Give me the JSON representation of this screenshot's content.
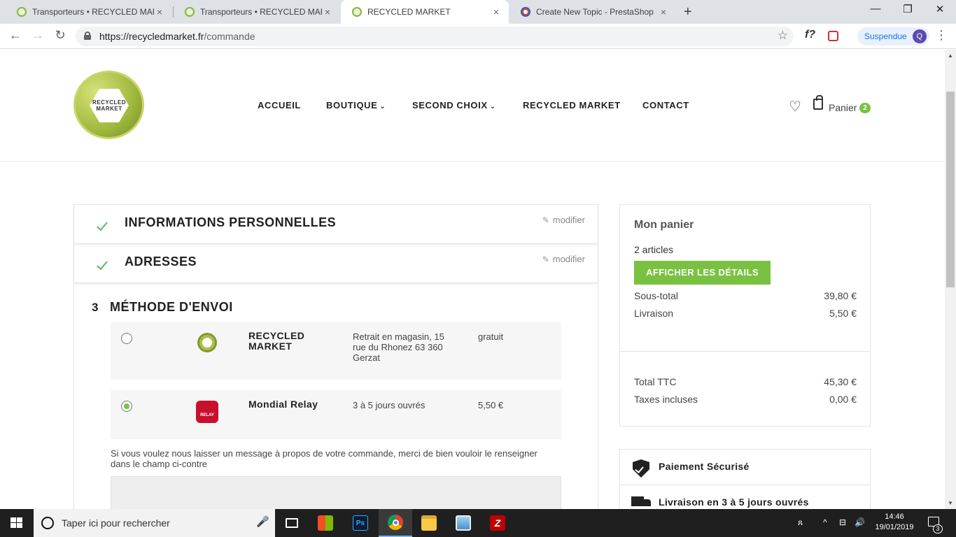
{
  "browser": {
    "tabs": [
      {
        "title": "Transporteurs • RECYCLED MARK",
        "close": "×"
      },
      {
        "title": "Transporteurs • RECYCLED MARK",
        "close": "×"
      },
      {
        "title": "RECYCLED MARKET",
        "close": "×"
      },
      {
        "title": "Create New Topic - PrestaShop",
        "close": "×"
      }
    ],
    "new_tab": "+",
    "window_controls": {
      "minimize": "—",
      "maximize": "❐",
      "close": "✕"
    },
    "nav": {
      "back": "←",
      "forward": "→",
      "reload": "↻"
    },
    "url_host": "https://recycledmarket.fr",
    "url_path": "/commande",
    "bookmark_star": "☆",
    "ext_f": "f?",
    "profile_label": "Suspendue",
    "profile_initial": "Q",
    "menu": "⋮"
  },
  "site": {
    "logo_text_1": "RECYCLED",
    "logo_text_2": "MARKET",
    "nav": [
      {
        "label": "ACCUEIL"
      },
      {
        "label": "BOUTIQUE",
        "chevron": "⌄"
      },
      {
        "label": "SECOND CHOIX",
        "chevron": "⌄"
      },
      {
        "label": "RECYCLED MARKET"
      },
      {
        "label": "CONTACT"
      }
    ],
    "heart": "♡",
    "cart_label": "Panier",
    "cart_count": "2"
  },
  "checkout": {
    "step1_title": "INFORMATIONS PERSONNELLES",
    "step2_title": "ADRESSES",
    "modify_label": "modifier",
    "pencil": "✎",
    "step3_num": "3",
    "step3_title": "MÉTHODE D'ENVOI",
    "carriers": [
      {
        "name_1": "RECYCLED",
        "name_2": "MARKET",
        "desc": "Retrait en magasin, 15 rue du Rhonez 63 360 Gerzat",
        "price": "gratuit",
        "selected": false
      },
      {
        "name_1": "Mondial Relay",
        "name_2": "",
        "desc": "3 à 5 jours ouvrés",
        "price": "5,50 €",
        "selected": true,
        "logo_text": "RELAY"
      }
    ],
    "message_label": "Si vous voulez nous laisser un message à propos de votre commande, merci de bien vouloir le renseigner dans le champ ci-contre"
  },
  "cart": {
    "title": "Mon panier",
    "items_count": "2 articles",
    "details_button": "AFFICHER LES DÉTAILS",
    "subtotal_label": "Sous-total",
    "subtotal_value": "39,80 €",
    "shipping_label": "Livraison",
    "shipping_value": "5,50 €",
    "total_label": "Total TTC",
    "total_value": "45,30 €",
    "taxes_label": "Taxes incluses",
    "taxes_value": "0,00 €"
  },
  "reassurance": [
    {
      "text": "Paiement Sécurisé"
    },
    {
      "text": "Livraison en 3 à 5 jours ouvrés"
    }
  ],
  "taskbar": {
    "search_placeholder": "Taper ici pour rechercher",
    "mic": "🎤",
    "ps_label": "Ps",
    "fz_label": "Z",
    "tray_people": "ጸ",
    "tray_up": "^",
    "tray_net": "⊟",
    "tray_vol": "🔊",
    "time": "14:46",
    "date": "19/01/2019",
    "notif_count": "3"
  }
}
